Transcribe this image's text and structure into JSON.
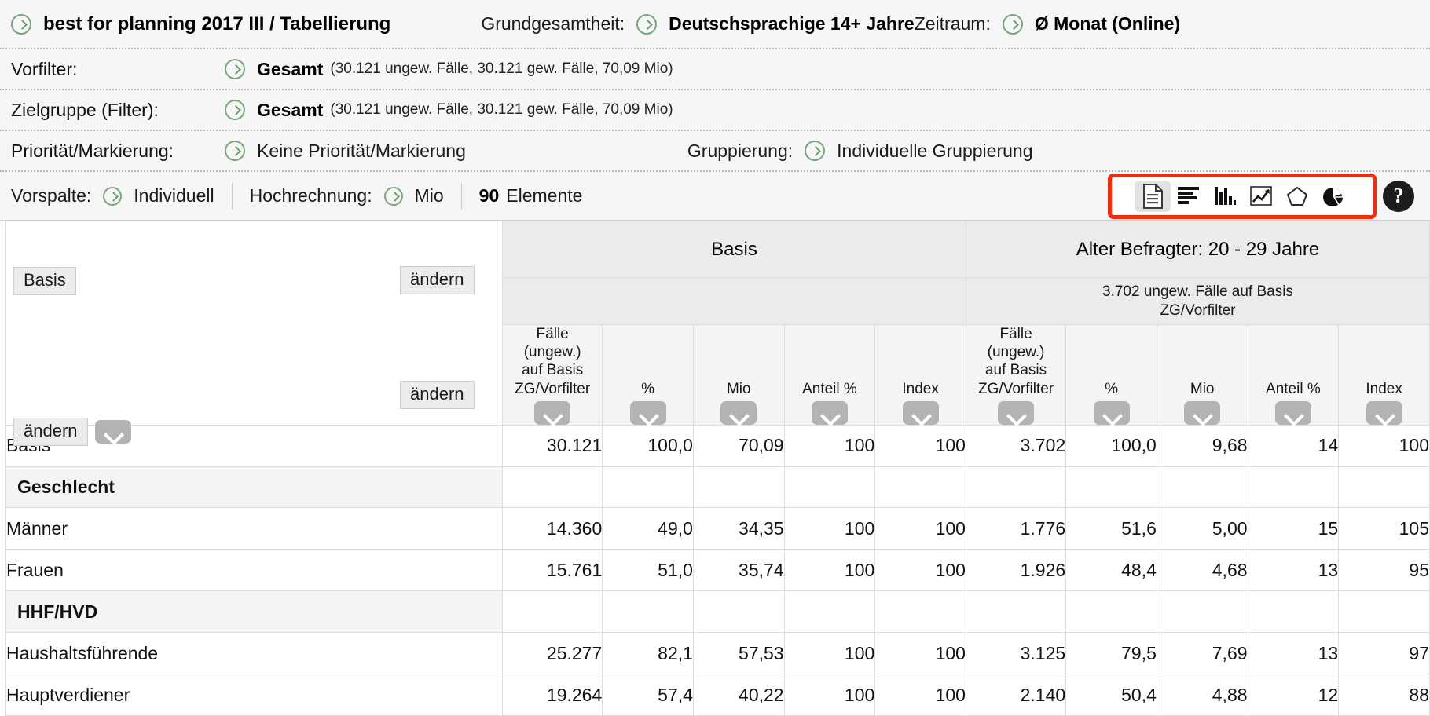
{
  "header": {
    "study_title": "best for planning 2017 III / Tabellierung",
    "grundgesamtheit_label": "Grundgesamtheit:",
    "grundgesamtheit_value": "Deutschsprachige 14+ Jahre",
    "zeitraum_label": "Zeitraum:",
    "zeitraum_value": "Ø Monat (Online)",
    "vorfilter_label": "Vorfilter:",
    "vorfilter_value": "Gesamt",
    "vorfilter_detail": "(30.121 ungew. Fälle, 30.121 gew. Fälle, 70,09 Mio)",
    "zielgruppe_label": "Zielgruppe (Filter):",
    "zielgruppe_value": "Gesamt",
    "zielgruppe_detail": "(30.121 ungew. Fälle, 30.121 gew. Fälle, 70,09 Mio)",
    "prioritaet_label": "Priorität/Markierung:",
    "prioritaet_value": "Keine Priorität/Markierung",
    "gruppierung_label": "Gruppierung:",
    "gruppierung_value": "Individuelle Gruppierung",
    "vorspalte_label": "Vorspalte:",
    "vorspalte_value": "Individuell",
    "hochrechnung_label": "Hochrechnung:",
    "hochrechnung_value": "Mio",
    "elemente_count": "90",
    "elemente_label": "Elemente"
  },
  "toolbar": {
    "highlight_color": "#f42c0c",
    "active_index": 0,
    "icons": [
      {
        "name": "table-view-icon",
        "title": "Tabelle"
      },
      {
        "name": "horizontal-bar-chart-icon",
        "title": "Balkendiagramm"
      },
      {
        "name": "vertical-bar-chart-icon",
        "title": "Säulendiagramm"
      },
      {
        "name": "line-chart-icon",
        "title": "Liniendiagramm"
      },
      {
        "name": "radar-chart-icon",
        "title": "Netzdiagramm"
      },
      {
        "name": "pie-chart-icon",
        "title": "Kreisdiagramm"
      }
    ],
    "help_label": "?"
  },
  "side_panel": {
    "basis_button": "Basis",
    "aendern_button": "ändern",
    "aendern_button_2": "ändern",
    "aendern_button_3": "ändern"
  },
  "table": {
    "column_groups": [
      {
        "title": "Basis",
        "subtitle": ""
      },
      {
        "title": "Alter Befragter: 20 - 29 Jahre",
        "subtitle": "3.702 ungew. Fälle auf Basis ZG/Vorfilter"
      }
    ],
    "columns": [
      "Fälle (ungew.) auf Basis ZG/Vorfilter",
      "%",
      "Mio",
      "Anteil %",
      "Index",
      "Fälle (ungew.) auf Basis ZG/Vorfilter",
      "%",
      "Mio",
      "Anteil %",
      "Index"
    ],
    "column_caption_lines": [
      [
        "Fälle",
        "(ungew.)",
        "auf Basis",
        "ZG/Vorfilter"
      ],
      [
        "%"
      ],
      [
        "Mio"
      ],
      [
        "Anteil %"
      ],
      [
        "Index"
      ],
      [
        "Fälle",
        "(ungew.)",
        "auf Basis",
        "ZG/Vorfilter"
      ],
      [
        "%"
      ],
      [
        "Mio"
      ],
      [
        "Anteil %"
      ],
      [
        "Index"
      ]
    ],
    "rows": [
      {
        "type": "data",
        "label": "Basis",
        "values": [
          "30.121",
          "100,0",
          "70,09",
          "100",
          "100",
          "3.702",
          "100,0",
          "9,68",
          "14",
          "100"
        ]
      },
      {
        "type": "section",
        "label": "Geschlecht",
        "values": [
          "",
          "",
          "",
          "",
          "",
          "",
          "",
          "",
          "",
          ""
        ]
      },
      {
        "type": "data",
        "label": "Männer",
        "values": [
          "14.360",
          "49,0",
          "34,35",
          "100",
          "100",
          "1.776",
          "51,6",
          "5,00",
          "15",
          "105"
        ]
      },
      {
        "type": "data",
        "label": "Frauen",
        "values": [
          "15.761",
          "51,0",
          "35,74",
          "100",
          "100",
          "1.926",
          "48,4",
          "4,68",
          "13",
          "95"
        ]
      },
      {
        "type": "section",
        "label": "HHF/HVD",
        "values": [
          "",
          "",
          "",
          "",
          "",
          "",
          "",
          "",
          "",
          ""
        ]
      },
      {
        "type": "data",
        "label": "Haushaltsführende",
        "values": [
          "25.277",
          "82,1",
          "57,53",
          "100",
          "100",
          "3.125",
          "79,5",
          "7,69",
          "13",
          "97"
        ]
      },
      {
        "type": "data",
        "label": "Hauptverdiener",
        "values": [
          "19.264",
          "57,4",
          "40,22",
          "100",
          "100",
          "2.140",
          "50,4",
          "4,88",
          "12",
          "88"
        ]
      }
    ]
  }
}
